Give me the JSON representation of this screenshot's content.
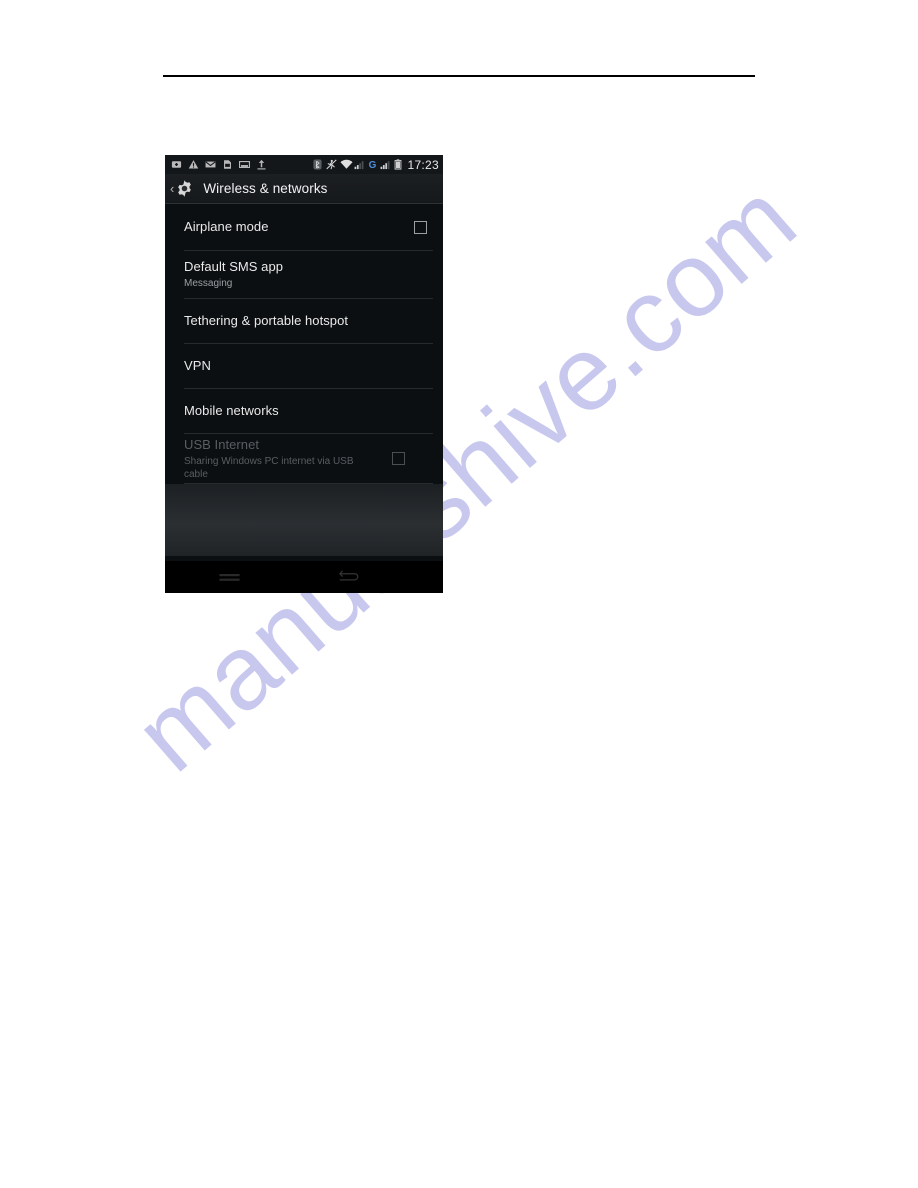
{
  "document": {
    "watermark_text": "manualshive.com",
    "watermark_color": "#c8c8ef",
    "rule_color": "#000000"
  },
  "phone": {
    "status_bar": {
      "time": "17:23",
      "left_icons": [
        "sync-icon",
        "warning-icon",
        "email-icon",
        "sim-card-icon",
        "screenshot-icon",
        "upload-icon"
      ],
      "right_icons": [
        "bluetooth-icon",
        "vibrate-silent-icon",
        "wifi-icon",
        "signal-bars-sim1-icon",
        "gprs-g-icon",
        "signal-bars-sim2-icon",
        "battery-icon"
      ],
      "gprs_label": "G",
      "gprs_color": "#4f8fd6"
    },
    "action_bar": {
      "back_chevron": "chevron-left-icon",
      "app_icon": "settings-gear-icon",
      "title": "Wireless & networks"
    },
    "list": {
      "items": [
        {
          "title": "Airplane mode",
          "subtitle": "",
          "control": "checkbox",
          "checked": false,
          "enabled": true
        },
        {
          "title": "Default SMS app",
          "subtitle": "Messaging",
          "control": "none",
          "checked": false,
          "enabled": true
        },
        {
          "title": "Tethering & portable hotspot",
          "subtitle": "",
          "control": "none",
          "checked": false,
          "enabled": true
        },
        {
          "title": "VPN",
          "subtitle": "",
          "control": "none",
          "checked": false,
          "enabled": true
        },
        {
          "title": "Mobile networks",
          "subtitle": "",
          "control": "none",
          "checked": false,
          "enabled": true
        },
        {
          "title": "USB Internet",
          "subtitle": "Sharing Windows PC internet via USB cable",
          "control": "checkbox",
          "checked": false,
          "enabled": false
        }
      ]
    },
    "nav_bar": {
      "menu_label": "menu-icon",
      "back_label": "back-icon"
    }
  }
}
